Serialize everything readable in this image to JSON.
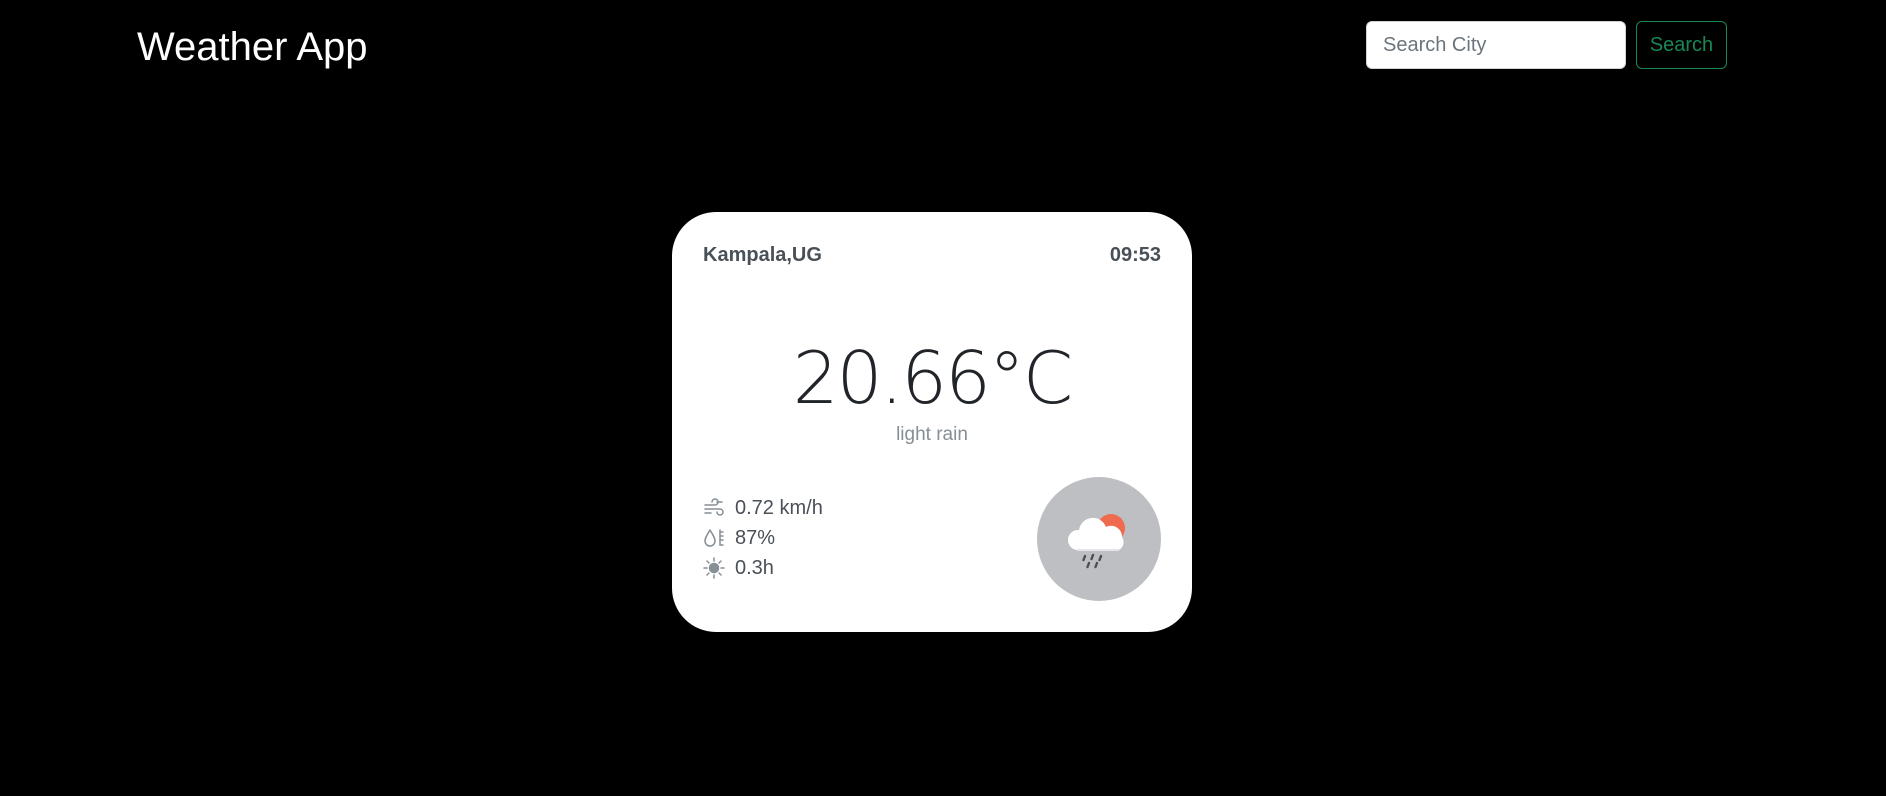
{
  "header": {
    "title": "Weather App"
  },
  "search": {
    "placeholder": "Search City",
    "value": "",
    "button_label": "Search"
  },
  "card": {
    "location": "Kampala,UG",
    "time": "09:53",
    "temperature": "20.66°C",
    "description": "light rain",
    "stats": {
      "wind": "0.72 km/h",
      "humidity": "87%",
      "sunshine": "0.3h"
    },
    "icons": {
      "wind": "wind-icon",
      "humidity": "droplet-thermometer-icon",
      "sunshine": "sun-icon",
      "weather": "rain-cloud-sun-icon"
    }
  },
  "colors": {
    "background": "#000000",
    "card": "#ffffff",
    "accent": "#198754",
    "sun": "#ee6b4d",
    "icon_circle": "#bdbfc3"
  }
}
